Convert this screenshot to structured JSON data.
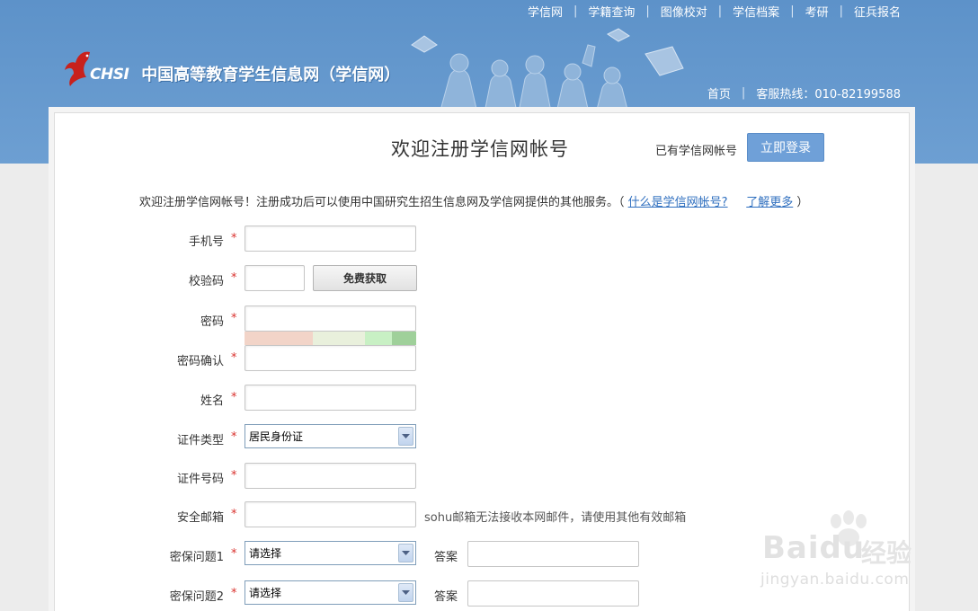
{
  "top_nav": [
    "学信网",
    "学籍查询",
    "图像校对",
    "学信档案",
    "考研",
    "征兵报名"
  ],
  "logo": {
    "brand": "CHSI",
    "name": "中国高等教育学生信息网（学信网）"
  },
  "sub_nav": {
    "home": "首页",
    "hotline": "客服热线：010-82199588"
  },
  "page": {
    "title": "欢迎注册学信网帐号",
    "has_account": "已有学信网帐号",
    "login_button": "立即登录",
    "intro_text": "欢迎注册学信网帐号！注册成功后可以使用中国研究生招生信息网及学信网提供的其他服务。（",
    "intro_link1": "什么是学信网帐号?",
    "intro_link2": "了解更多",
    "intro_close": "）"
  },
  "form": {
    "required_mark": "*",
    "phone_label": "手机号",
    "code_label": "校验码",
    "get_code_button": "免费获取",
    "password_label": "密码",
    "password_confirm_label": "密码确认",
    "name_label": "姓名",
    "id_type_label": "证件类型",
    "id_type_value": "居民身份证",
    "id_number_label": "证件号码",
    "email_label": "安全邮箱",
    "email_hint": "sohu邮箱无法接收本网邮件，请使用其他有效邮箱",
    "q1_label": "密保问题1",
    "q1_value": "请选择",
    "q2_label": "密保问题2",
    "q2_value": "请选择",
    "answer_label": "答案"
  },
  "colors": {
    "header_blue": "#6d9fd2",
    "login_button": "#6fa0d8",
    "required_star": "#d9302c",
    "link": "#2f6fbf",
    "strength_weak": "#f2d4c8",
    "strength_mid": "#e9f0dc",
    "strength_strong": "#9fe09a"
  },
  "watermark": {
    "brand": "Baidu",
    "name": "经验",
    "url": "jingyan.baidu.com"
  }
}
